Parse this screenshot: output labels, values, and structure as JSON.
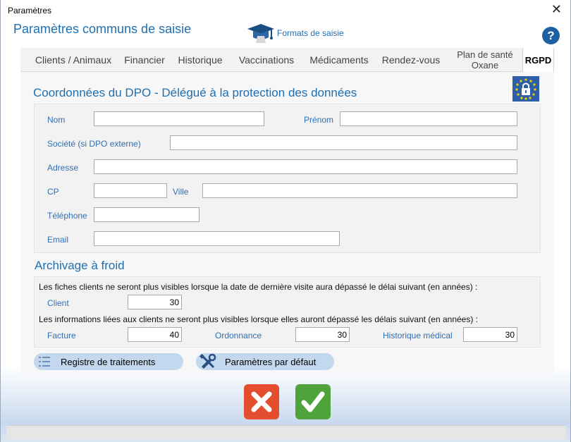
{
  "window": {
    "title": "Paramètres",
    "close_glyph": "✕"
  },
  "header": {
    "title": "Paramètres communs  de saisie",
    "formats_label": "Formats de saisie",
    "formats_icon": "graduation-cap-icon",
    "help_label": "?"
  },
  "tabs": [
    {
      "label": "Clients / Animaux"
    },
    {
      "label": "Financier"
    },
    {
      "label": "Historique"
    },
    {
      "label": "Vaccinations"
    },
    {
      "label": "Médicaments"
    },
    {
      "label": "Rendez-vous"
    },
    {
      "label": "Plan de santé Oxane"
    },
    {
      "label": "RGPD",
      "active": true
    }
  ],
  "dpo": {
    "title": "Coordonnées du DPO - Délégué à la protection des données",
    "icon": "eu-lock-icon",
    "nom_label": "Nom",
    "nom_value": "",
    "prenom_label": "Prénom",
    "prenom_value": "",
    "societe_label": "Société (si DPO externe)",
    "societe_value": "",
    "adresse_label": "Adresse",
    "adresse_value": "",
    "cp_label": "CP",
    "cp_value": "",
    "ville_label": "Ville",
    "ville_value": "",
    "telephone_label": "Téléphone",
    "telephone_value": "",
    "email_label": "Email",
    "email_value": ""
  },
  "archivage": {
    "title": "Archivage à froid",
    "clients_text": "Les fiches clients ne seront plus visibles lorsque la date de dernière visite aura dépassé le délai suivant (en années) :",
    "client_label": "Client",
    "client_value": "30",
    "infos_text": "Les informations liées aux clients ne seront plus visibles lorsque elles auront dépassé les délais suivant (en années) :",
    "facture_label": "Facture",
    "facture_value": "40",
    "ordonnance_label": "Ordonnance",
    "ordonnance_value": "30",
    "historique_label": "Historique médical",
    "historique_value": "30"
  },
  "actions": {
    "registre_label": "Registre de traitements",
    "defaut_label": "Paramètres par défaut"
  },
  "colors": {
    "accent": "#1f6fb0",
    "label": "#2f6fb5",
    "cancel": "#e44d2e",
    "ok": "#4ea43b",
    "pill": "#c3d8ee"
  }
}
